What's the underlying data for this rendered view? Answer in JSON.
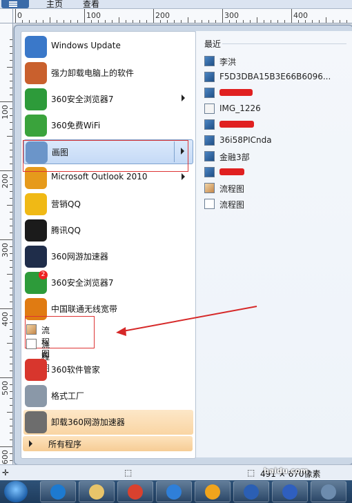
{
  "toolbar": {
    "tab_home": "主页",
    "tab_view": "查看"
  },
  "ruler": {
    "h_labels": [
      "0",
      "100",
      "200",
      "300",
      "400"
    ],
    "v_labels": [
      "100",
      "200",
      "300",
      "400",
      "500",
      "600"
    ]
  },
  "start_menu": {
    "programs": [
      {
        "label": "Windows Update",
        "icon": "windows-update-icon",
        "color": "#3a78c9"
      },
      {
        "label": "强力卸载电脑上的软件",
        "icon": "uninstall-tool-icon",
        "color": "#c9602d"
      },
      {
        "label": "360安全浏览器7",
        "icon": "360-browser-icon",
        "color": "#2d9b3a",
        "has_submenu": true
      },
      {
        "label": "360免费WiFi",
        "icon": "wifi-icon",
        "color": "#3aa33c"
      },
      {
        "label": "画图",
        "icon": "paint-icon",
        "color": "#6b95c9",
        "has_submenu": true,
        "selected": true
      },
      {
        "label": "Microsoft Outlook 2010",
        "icon": "outlook-icon",
        "color": "#e69a1b",
        "has_submenu": true
      },
      {
        "label": "营销QQ",
        "icon": "qq-marketing-icon",
        "color": "#f0b915"
      },
      {
        "label": "腾讯QQ",
        "icon": "qq-penguin-icon",
        "color": "#1b1b1b"
      },
      {
        "label": "360网游加速器",
        "icon": "game-accelerator-icon",
        "color": "#1f2d4a"
      },
      {
        "label": "360安全浏览器7",
        "icon": "360-browser-icon",
        "color": "#2d9b3a",
        "badge": "2"
      },
      {
        "label": "中国联通无线宽带",
        "icon": "unicom-icon",
        "color": "#e07b12"
      }
    ],
    "submenu": [
      {
        "label": "流程图",
        "icon": "paint-file-icon"
      },
      {
        "label": "流程图",
        "icon": "flowchart-icon"
      }
    ],
    "programs_bottom": [
      {
        "label": "360软件管家",
        "icon": "software-manager-icon",
        "color": "#d8362d"
      },
      {
        "label": "格式工厂",
        "icon": "format-factory-icon",
        "color": "#8a98a8"
      },
      {
        "label": "卸载360网游加速器",
        "icon": "trash-icon",
        "color": "#6d6d6d",
        "highlighted": true
      }
    ],
    "all_programs": "所有程序",
    "recent_title": "最近",
    "recent": [
      {
        "label": "李洪",
        "icon": "image-file-icon"
      },
      {
        "label": "F5D3DBA15B3E66B6096...",
        "icon": "image-file-icon"
      },
      {
        "label": "",
        "icon": "image-file-icon",
        "redacted": true,
        "redact_w": 48
      },
      {
        "label": "IMG_1226",
        "icon": "document-file-icon"
      },
      {
        "label": "",
        "icon": "image-file-icon",
        "redacted": true,
        "redact_w": 50
      },
      {
        "label": "36i58PICnda",
        "icon": "image-file-icon"
      },
      {
        "label": "金融3部",
        "icon": "image-file-icon"
      },
      {
        "label": "",
        "icon": "image-file-icon",
        "redacted": true,
        "redact_w": 36
      },
      {
        "label": "流程图",
        "icon": "paint-file-icon"
      },
      {
        "label": "流程图",
        "icon": "flowchart-icon"
      }
    ]
  },
  "statusbar": {
    "size": "491 × 670像素"
  },
  "taskbar": {
    "apps": [
      "start-orb-icon",
      "internet-explorer-icon",
      "file-explorer-icon",
      "chrome-icon",
      "pen-app-icon",
      "outlook-icon",
      "word-icon",
      "baidu-icon",
      "app-icon"
    ]
  },
  "watermark": "baidu.com"
}
